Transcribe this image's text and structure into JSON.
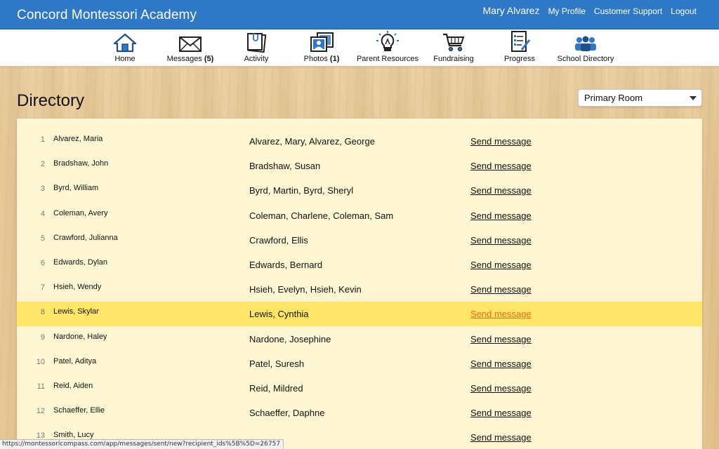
{
  "header": {
    "brand": "Concord Montessori Academy",
    "user_name": "Mary Alvarez",
    "links": [
      "My Profile",
      "Customer Support",
      "Logout"
    ]
  },
  "nav": [
    {
      "label": "Home",
      "count": "",
      "icon": "home-icon"
    },
    {
      "label": "Messages",
      "count": "(5)",
      "icon": "envelope-icon"
    },
    {
      "label": "Activity",
      "count": "",
      "icon": "notepad-icon"
    },
    {
      "label": "Photos",
      "count": "(1)",
      "icon": "photos-icon"
    },
    {
      "label": "Parent Resources",
      "count": "",
      "icon": "lightbulb-icon"
    },
    {
      "label": "Fundraising",
      "count": "",
      "icon": "shopping-cart-icon"
    },
    {
      "label": "Progress",
      "count": "",
      "icon": "checklist-icon"
    },
    {
      "label": "School Directory",
      "count": "",
      "icon": "people-icon"
    }
  ],
  "page": {
    "title": "Directory",
    "room_select": "Primary Room"
  },
  "directory": {
    "send_label": "Send message",
    "rows": [
      {
        "num": "1",
        "child": "Alvarez, Maria",
        "parents": "Alvarez, Mary, Alvarez, George"
      },
      {
        "num": "2",
        "child": "Bradshaw, John",
        "parents": "Bradshaw, Susan"
      },
      {
        "num": "3",
        "child": "Byrd, William",
        "parents": "Byrd, Martin, Byrd, Sheryl"
      },
      {
        "num": "4",
        "child": "Coleman, Avery",
        "parents": "Coleman, Charlene, Coleman, Sam"
      },
      {
        "num": "5",
        "child": "Crawford, Julianna",
        "parents": "Crawford, Ellis"
      },
      {
        "num": "6",
        "child": "Edwards, Dylan",
        "parents": "Edwards, Bernard"
      },
      {
        "num": "7",
        "child": "Hsieh, Wendy",
        "parents": "Hsieh, Evelyn, Hsieh, Kevin"
      },
      {
        "num": "8",
        "child": "Lewis, Skylar",
        "parents": "Lewis, Cynthia",
        "highlighted": true
      },
      {
        "num": "9",
        "child": "Nardone, Haley",
        "parents": "Nardone, Josephine"
      },
      {
        "num": "10",
        "child": "Patel, Aditya",
        "parents": "Patel, Suresh"
      },
      {
        "num": "11",
        "child": "Reid, Aiden",
        "parents": "Reid, Mildred"
      },
      {
        "num": "12",
        "child": "Schaeffer, Ellie",
        "parents": "Schaeffer, Daphne"
      },
      {
        "num": "13",
        "child": "Smith, Lucy",
        "parents": ""
      }
    ]
  },
  "status_url": "https://montessoricompass.com/app/messages/sent/new?recipient_ids%5B%5D=26757",
  "colors": {
    "header_bg": "#2f78c5",
    "panel_bg": "#fff7d3",
    "highlight_row": "#ffe666",
    "link_hover": "#f06a0f"
  }
}
